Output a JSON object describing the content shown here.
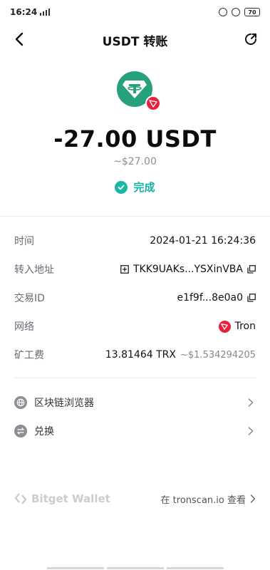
{
  "status_bar": {
    "time": "16:24",
    "battery": "70"
  },
  "nav": {
    "title": "USDT 转账"
  },
  "hero": {
    "amount": "-27.00 USDT",
    "fiat": "~$27.00",
    "status": "完成"
  },
  "details": {
    "rows": [
      {
        "label": "时间",
        "value": "2024-01-21 16:24:36"
      },
      {
        "label": "转入地址",
        "value": "TKK9UAKs...YSXinVBA"
      },
      {
        "label": "交易ID",
        "value": "e1f9f...8e0a0"
      },
      {
        "label": "网络",
        "value": "Tron"
      },
      {
        "label": "矿工费",
        "value": "13.81464 TRX",
        "sub": "~$1.534294205"
      }
    ]
  },
  "links": [
    {
      "label": "区块链浏览器"
    },
    {
      "label": "兑换"
    }
  ],
  "footer": {
    "brand": "Bitget Wallet",
    "tronscan": "在 tronscan.io 查看"
  },
  "colors": {
    "accent": "#15b2a2",
    "tether": "#26a17b",
    "tron": "#e8203a"
  }
}
